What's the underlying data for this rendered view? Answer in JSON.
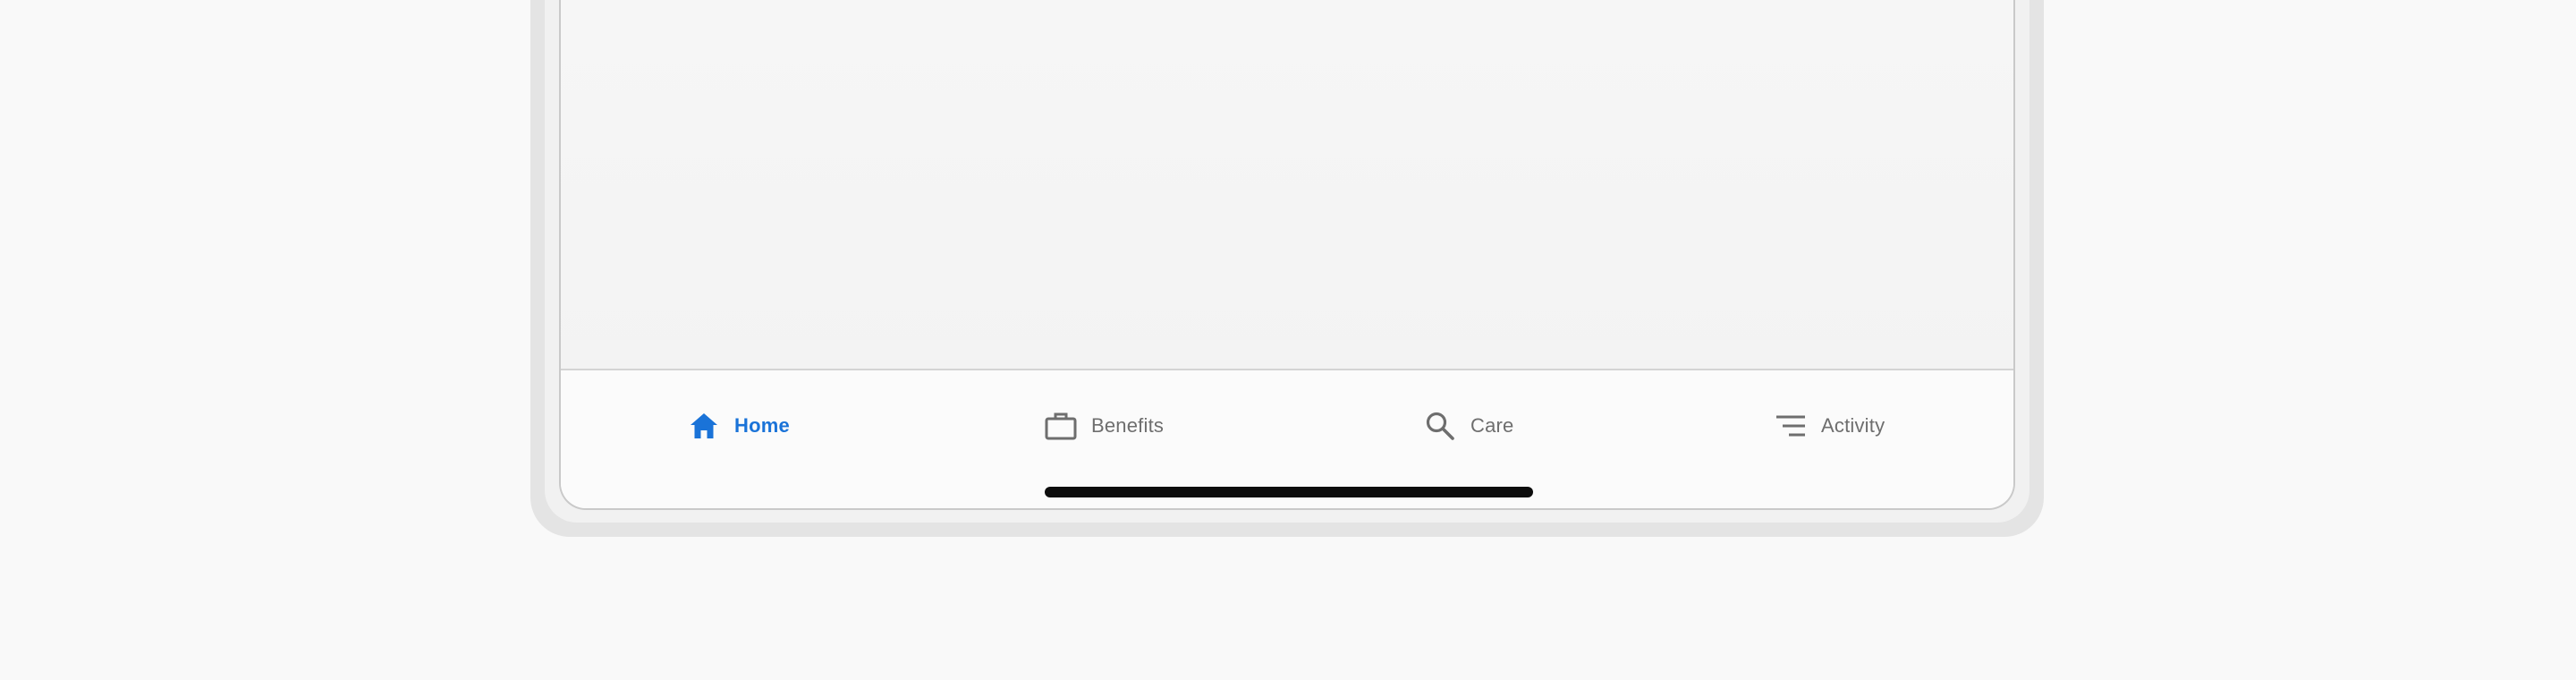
{
  "tab_bar": {
    "active_tab": "home",
    "accent_color": "#1a73d8",
    "inactive_color": "#6e6e6e",
    "tabs": [
      {
        "id": "home",
        "label": "Home",
        "icon": "home-icon"
      },
      {
        "id": "benefits",
        "label": "Benefits",
        "icon": "briefcase-icon"
      },
      {
        "id": "care",
        "label": "Care",
        "icon": "search-icon"
      },
      {
        "id": "activity",
        "label": "Activity",
        "icon": "list-lines-icon"
      }
    ]
  }
}
